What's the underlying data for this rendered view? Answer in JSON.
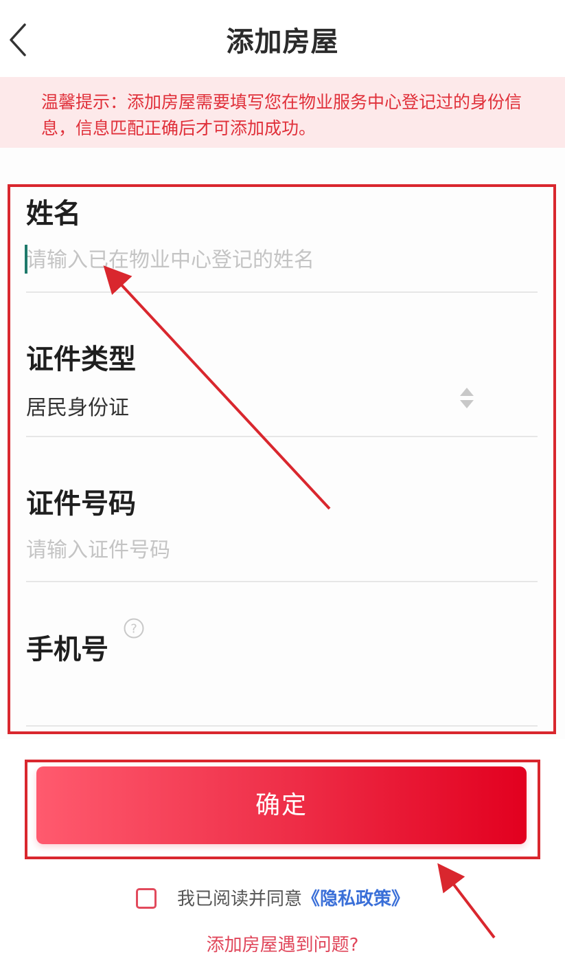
{
  "header": {
    "title": "添加房屋",
    "back_icon": "chevron-left-icon"
  },
  "notice": {
    "text": "温馨提示：添加房屋需要填写您在物业服务中心登记过的身份信息，信息匹配正确后才可添加成功。",
    "color": "#e0303a",
    "background": "#fde9ea"
  },
  "form": {
    "name": {
      "label": "姓名",
      "placeholder": "请输入已在物业中心登记的姓名"
    },
    "id_type": {
      "label": "证件类型",
      "value": "居民身份证",
      "icon": "sort-updown-icon"
    },
    "id_number": {
      "label": "证件号码",
      "placeholder": "请输入证件号码"
    },
    "phone": {
      "label": "手机号",
      "help_icon": "question-circle-icon"
    }
  },
  "confirm_button": {
    "label": "确定"
  },
  "agreement": {
    "prefix": "我已阅读并同意",
    "link": "《隐私政策》",
    "checked": false
  },
  "trouble_link": "添加房屋遇到问题?",
  "colors": {
    "accent": "#e2001f",
    "annotation": "#d9272e",
    "link_blue": "#3a6fd8"
  }
}
